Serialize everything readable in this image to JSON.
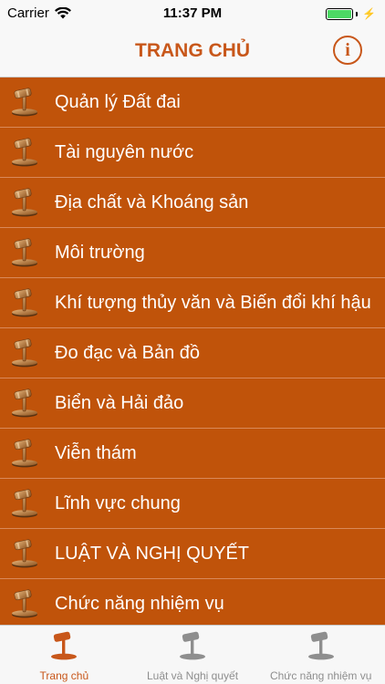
{
  "status_bar": {
    "carrier": "Carrier",
    "time": "11:37 PM"
  },
  "header": {
    "title": "TRANG CHỦ",
    "info_glyph": "i"
  },
  "list": {
    "items": [
      {
        "label": "Quản lý Đất đai"
      },
      {
        "label": "Tài nguyên nước"
      },
      {
        "label": "Địa chất và Khoáng sản"
      },
      {
        "label": "Môi trường"
      },
      {
        "label": "Khí tượng thủy văn và Biến đổi khí hậu"
      },
      {
        "label": "Đo đạc và Bản đồ"
      },
      {
        "label": "Biển và Hải đảo"
      },
      {
        "label": "Viễn thám"
      },
      {
        "label": "Lĩnh vực chung"
      },
      {
        "label": "LUẬT VÀ NGHỊ QUYẾT"
      },
      {
        "label": "Chức năng nhiệm vụ"
      }
    ]
  },
  "tab_bar": {
    "tabs": [
      {
        "label": "Trang chủ",
        "active": true
      },
      {
        "label": "Luật và Nghị quyết",
        "active": false
      },
      {
        "label": "Chức năng nhiệm vụ",
        "active": false
      }
    ]
  },
  "colors": {
    "accent": "#c8571a",
    "list_background": "#c0530a",
    "divider": "#d9895a",
    "tab_inactive": "#8e8e8e",
    "battery": "#4cd964"
  },
  "icons": {
    "row_icon": "gavel-icon",
    "info_icon": "info-icon",
    "wifi_icon": "wifi-icon",
    "battery_icon": "battery-icon"
  }
}
